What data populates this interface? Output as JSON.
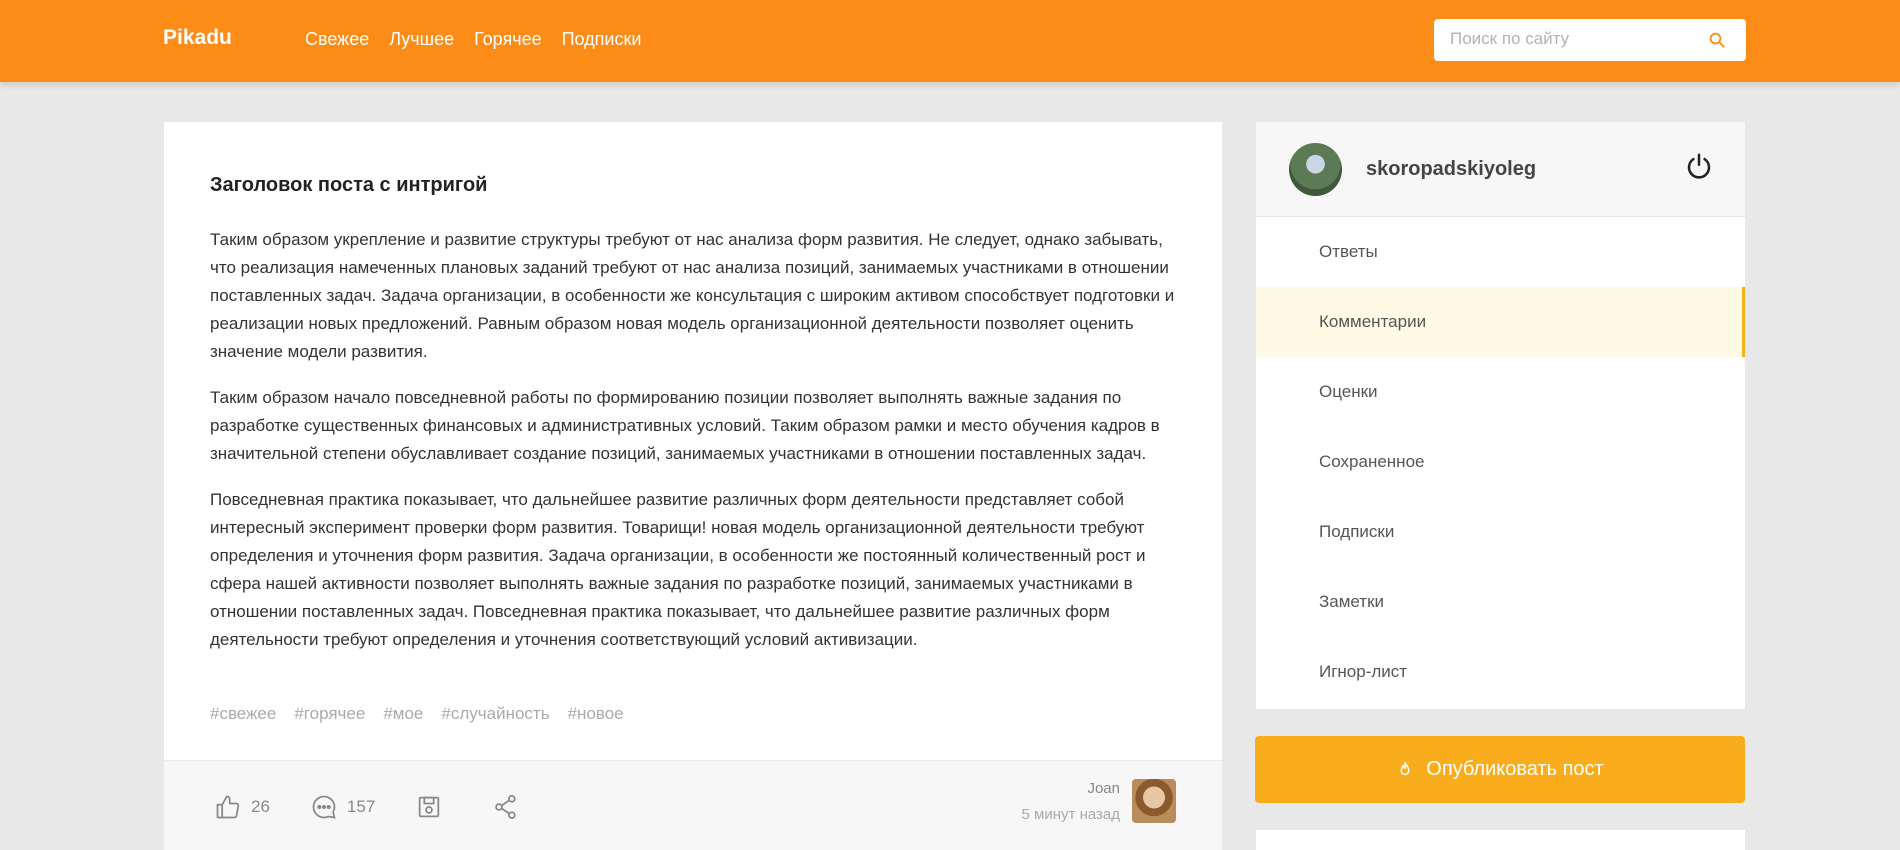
{
  "header": {
    "logo": "Pikadu",
    "nav": [
      "Свежее",
      "Лучшее",
      "Горячее",
      "Подписки"
    ],
    "search_placeholder": "Поиск по сайту"
  },
  "post": {
    "title": "Заголовок поста с интригой",
    "paragraphs": [
      "Таким образом укрепление и развитие структуры требуют от нас анализа форм развития. Не следует, однако забывать, что реализация намеченных плановых заданий требуют от нас анализа позиций, занимаемых участниками в отношении поставленных задач. Задача организации, в особенности же консультация с широким активом способствует подготовки и реализации новых предложений. Равным образом новая модель организационной деятельности позволяет оценить значение модели развития.",
      "Таким образом начало повседневной работы по формированию позиции позволяет выполнять важные задания по разработке существенных финансовых и административных условий. Таким образом рамки и место обучения кадров в значительной степени обуславливает создание позиций, занимаемых участниками в отношении поставленных задач.",
      "Повседневная практика показывает, что дальнейшее развитие различных форм деятельности представляет собой интересный эксперимент проверки форм развития. Товарищи! новая модель организационной деятельности требуют определения и уточнения форм развития. Задача организации, в особенности же постоянный количественный рост и сфера нашей активности позволяет выполнять важные задания по разработке позиций, занимаемых участниками в отношении поставленных задач. Повседневная практика показывает, что дальнейшее развитие различных форм деятельности требуют определения и уточнения соответствующий условий активизации."
    ],
    "tags": [
      "#свежее",
      "#горячее",
      "#мое",
      "#случайность",
      "#новое"
    ],
    "likes": "26",
    "comments": "157",
    "author_name": "Joan",
    "time": "5 минут назад"
  },
  "sidebar": {
    "username": "skoropadskiyoleg",
    "menu": [
      "Ответы",
      "Комментарии",
      "Оценки",
      "Сохраненное",
      "Подписки",
      "Заметки",
      "Игнор-лист"
    ],
    "active_index": 1,
    "publish_label": "Опубликовать пост"
  },
  "colors": {
    "header": "#fb8c18",
    "accent": "#f9ac1c",
    "active_bg": "#fffae6"
  }
}
